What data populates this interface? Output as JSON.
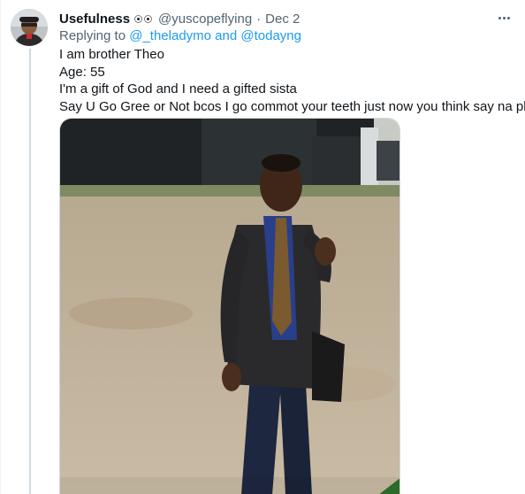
{
  "colors": {
    "link": "#1d9bf0",
    "secondary_text": "#536471",
    "primary_text": "#0f1419",
    "thread_line": "#cfd9de"
  },
  "tweet": {
    "display_name": "Usefulness",
    "name_emoji": "eyes-emoji",
    "handle": "@yuscopeflying",
    "separator": "·",
    "date": "Dec 2",
    "more_icon": "more-horizontal-icon",
    "replying_prefix": "Replying to",
    "mentions": [
      "@_theladymo",
      "@todayng"
    ],
    "mentions_joiner": "and",
    "text_lines": [
      "I am brother Theo",
      "Age: 55",
      "I'm a gift of God and I need a gifted sista",
      "Say U Go Gree or Not bcos I go commot your teeth just now you think say na play?"
    ],
    "media": {
      "type": "video",
      "thumbnail_icon": "man-in-suit-outdoor-photo"
    }
  }
}
